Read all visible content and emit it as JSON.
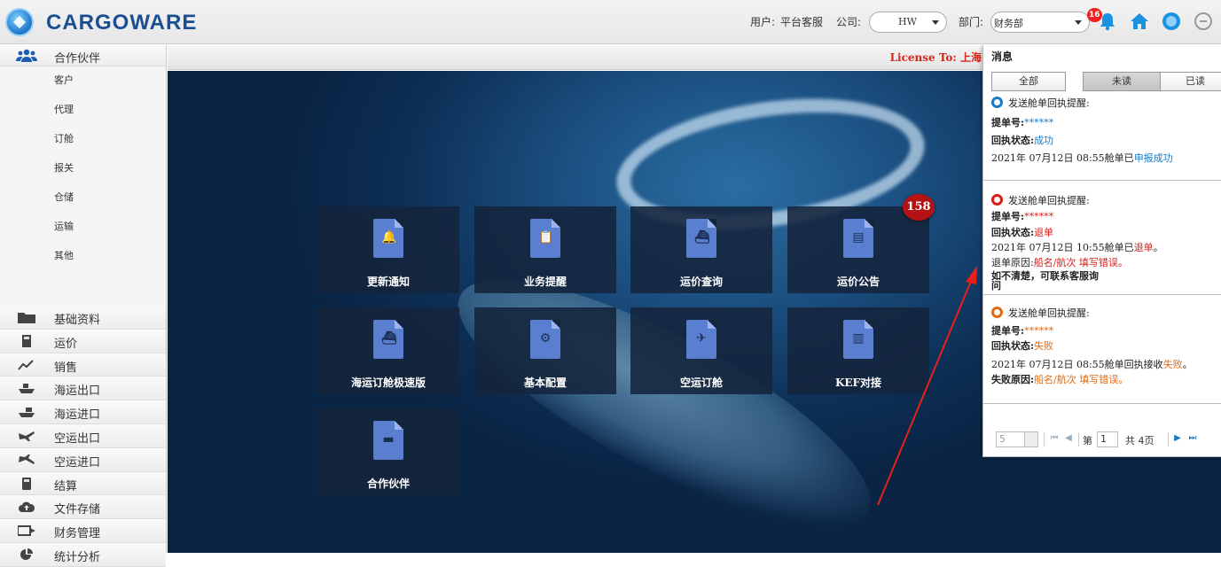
{
  "app": {
    "logo_text": "CARGOWARE"
  },
  "topbar": {
    "user_label": "用户:",
    "user_value": "平台客服",
    "company_label": "公司:",
    "company_value": "HW",
    "dept_label": "部门:",
    "dept_value": "财务部",
    "notification_count": "16"
  },
  "license": {
    "text": "License To: 上海"
  },
  "sidebar": {
    "partners": {
      "label": "合作伙伴",
      "items": [
        "客户",
        "代理",
        "订舱",
        "报关",
        "仓储",
        "运输",
        "其他"
      ]
    },
    "sections": [
      {
        "label": "基础资料",
        "icon": "folder-icon"
      },
      {
        "label": "运价",
        "icon": "price-icon"
      },
      {
        "label": "销售",
        "icon": "sales-icon"
      },
      {
        "label": "海运出口",
        "icon": "ship-export-icon"
      },
      {
        "label": "海运进口",
        "icon": "ship-import-icon"
      },
      {
        "label": "空运出口",
        "icon": "plane-export-icon"
      },
      {
        "label": "空运进口",
        "icon": "plane-import-icon"
      },
      {
        "label": "结算",
        "icon": "calculator-icon"
      },
      {
        "label": "文件存储",
        "icon": "cloud-upload-icon"
      },
      {
        "label": "财务管理",
        "icon": "finance-icon"
      },
      {
        "label": "统计分析",
        "icon": "pie-chart-icon"
      }
    ],
    "collapse_glyph": "‹"
  },
  "tiles": [
    {
      "label": "更新通知",
      "icon": "bell-icon",
      "glyph": "🔔"
    },
    {
      "label": "业务提醒",
      "icon": "clipboard-icon",
      "glyph": "📋"
    },
    {
      "label": "运价查询",
      "icon": "cargo-ship-icon",
      "glyph": "⛴"
    },
    {
      "label": "运价公告",
      "icon": "notice-board-icon",
      "glyph": "▤"
    },
    {
      "label": "海运订舱极速版",
      "icon": "fast-ship-icon",
      "glyph": "⛴"
    },
    {
      "label": "基本配置",
      "icon": "gear-icon",
      "glyph": "⚙"
    },
    {
      "label": "空运订舱",
      "icon": "airplane-icon",
      "glyph": "✈"
    },
    {
      "label": "KEF对接",
      "icon": "bar-chart-icon",
      "glyph": "▥"
    },
    {
      "label": "合作伙伴",
      "icon": "folder-open-icon",
      "glyph": "▬"
    }
  ],
  "badge": {
    "count": "158"
  },
  "messages": {
    "title": "消息",
    "tabs": [
      "全部",
      "未读",
      "已读"
    ],
    "active_tab": "未读",
    "items": [
      {
        "header": "发送舱单回执提醒:",
        "color": "#1b7ac4",
        "bill_label": "提单号:",
        "bill_value": "******",
        "status_label": "回执状态:",
        "status_value": "成功",
        "line3_prefix": "2021年 07月12日 08:55舱单已",
        "line3_highlight": "申报成功",
        "line3_suffix": "",
        "line4_label": "",
        "line4_value": "",
        "line5": "",
        "line6": ""
      },
      {
        "header": "发送舱单回执提醒:",
        "color": "#d91e18",
        "bill_label": "提单号:",
        "bill_value": "******",
        "status_label": "回执状态:",
        "status_value": "退单",
        "line3_prefix": "2021年 07月12日 10:55舱单已",
        "line3_highlight": "退单",
        "line3_suffix": "。",
        "line4_label": "退单原因:",
        "line4_value": "船名/航次 填写错误。",
        "line5": "如不清楚，可联系客服询",
        "line6": "问"
      },
      {
        "header": "发送舱单回执提醒:",
        "color": "#e06a12",
        "bill_label": "提单号:",
        "bill_value": "******",
        "status_label": "回执状态:",
        "status_value": "失败",
        "line3_prefix": "2021年 07月12日 08:55舱单回执接收",
        "line3_highlight": "失败",
        "line3_suffix": "。",
        "line4_label": "失败原因:",
        "line4_value": "船名/航次 填写错误。",
        "line5": "",
        "line6": ""
      }
    ],
    "pager": {
      "page_size": "5",
      "page_prefix": "第",
      "current_page": "1",
      "total_text": "共 4页"
    }
  }
}
